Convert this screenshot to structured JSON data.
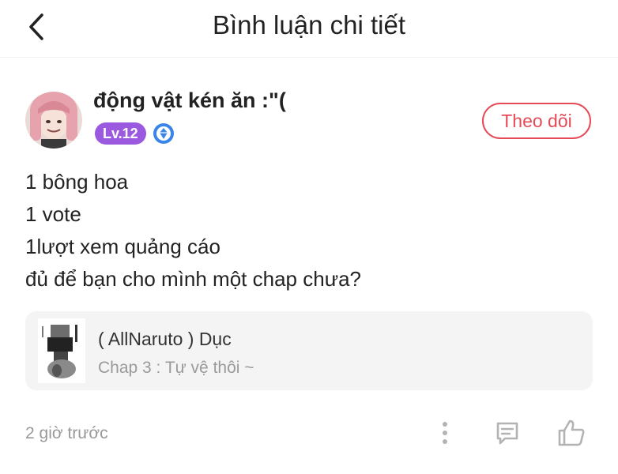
{
  "header": {
    "title": "Bình luận chi tiết",
    "back_icon": "chevron-left-icon"
  },
  "user": {
    "name": "động vật kén ăn :\"(",
    "level": "Lv.12",
    "follow_label": "Theo dõi",
    "badge_icon": "diamond-badge-icon"
  },
  "comment": {
    "lines": [
      "1 bông hoa",
      "1 vote",
      "1lượt xem quảng cáo",
      "đủ để bạn cho mình một chap chưa?"
    ]
  },
  "reference": {
    "title": "( AllNaruto ) Dục",
    "chapter": "Chap 3 : Tự vệ thôi ~"
  },
  "footer": {
    "time": "2 giờ trước",
    "icons": [
      "more-vertical-icon",
      "comment-icon",
      "like-icon"
    ]
  },
  "colors": {
    "accent": "#e64a57",
    "level_badge": "#9b59e0",
    "card_bg": "#f4f4f4"
  }
}
